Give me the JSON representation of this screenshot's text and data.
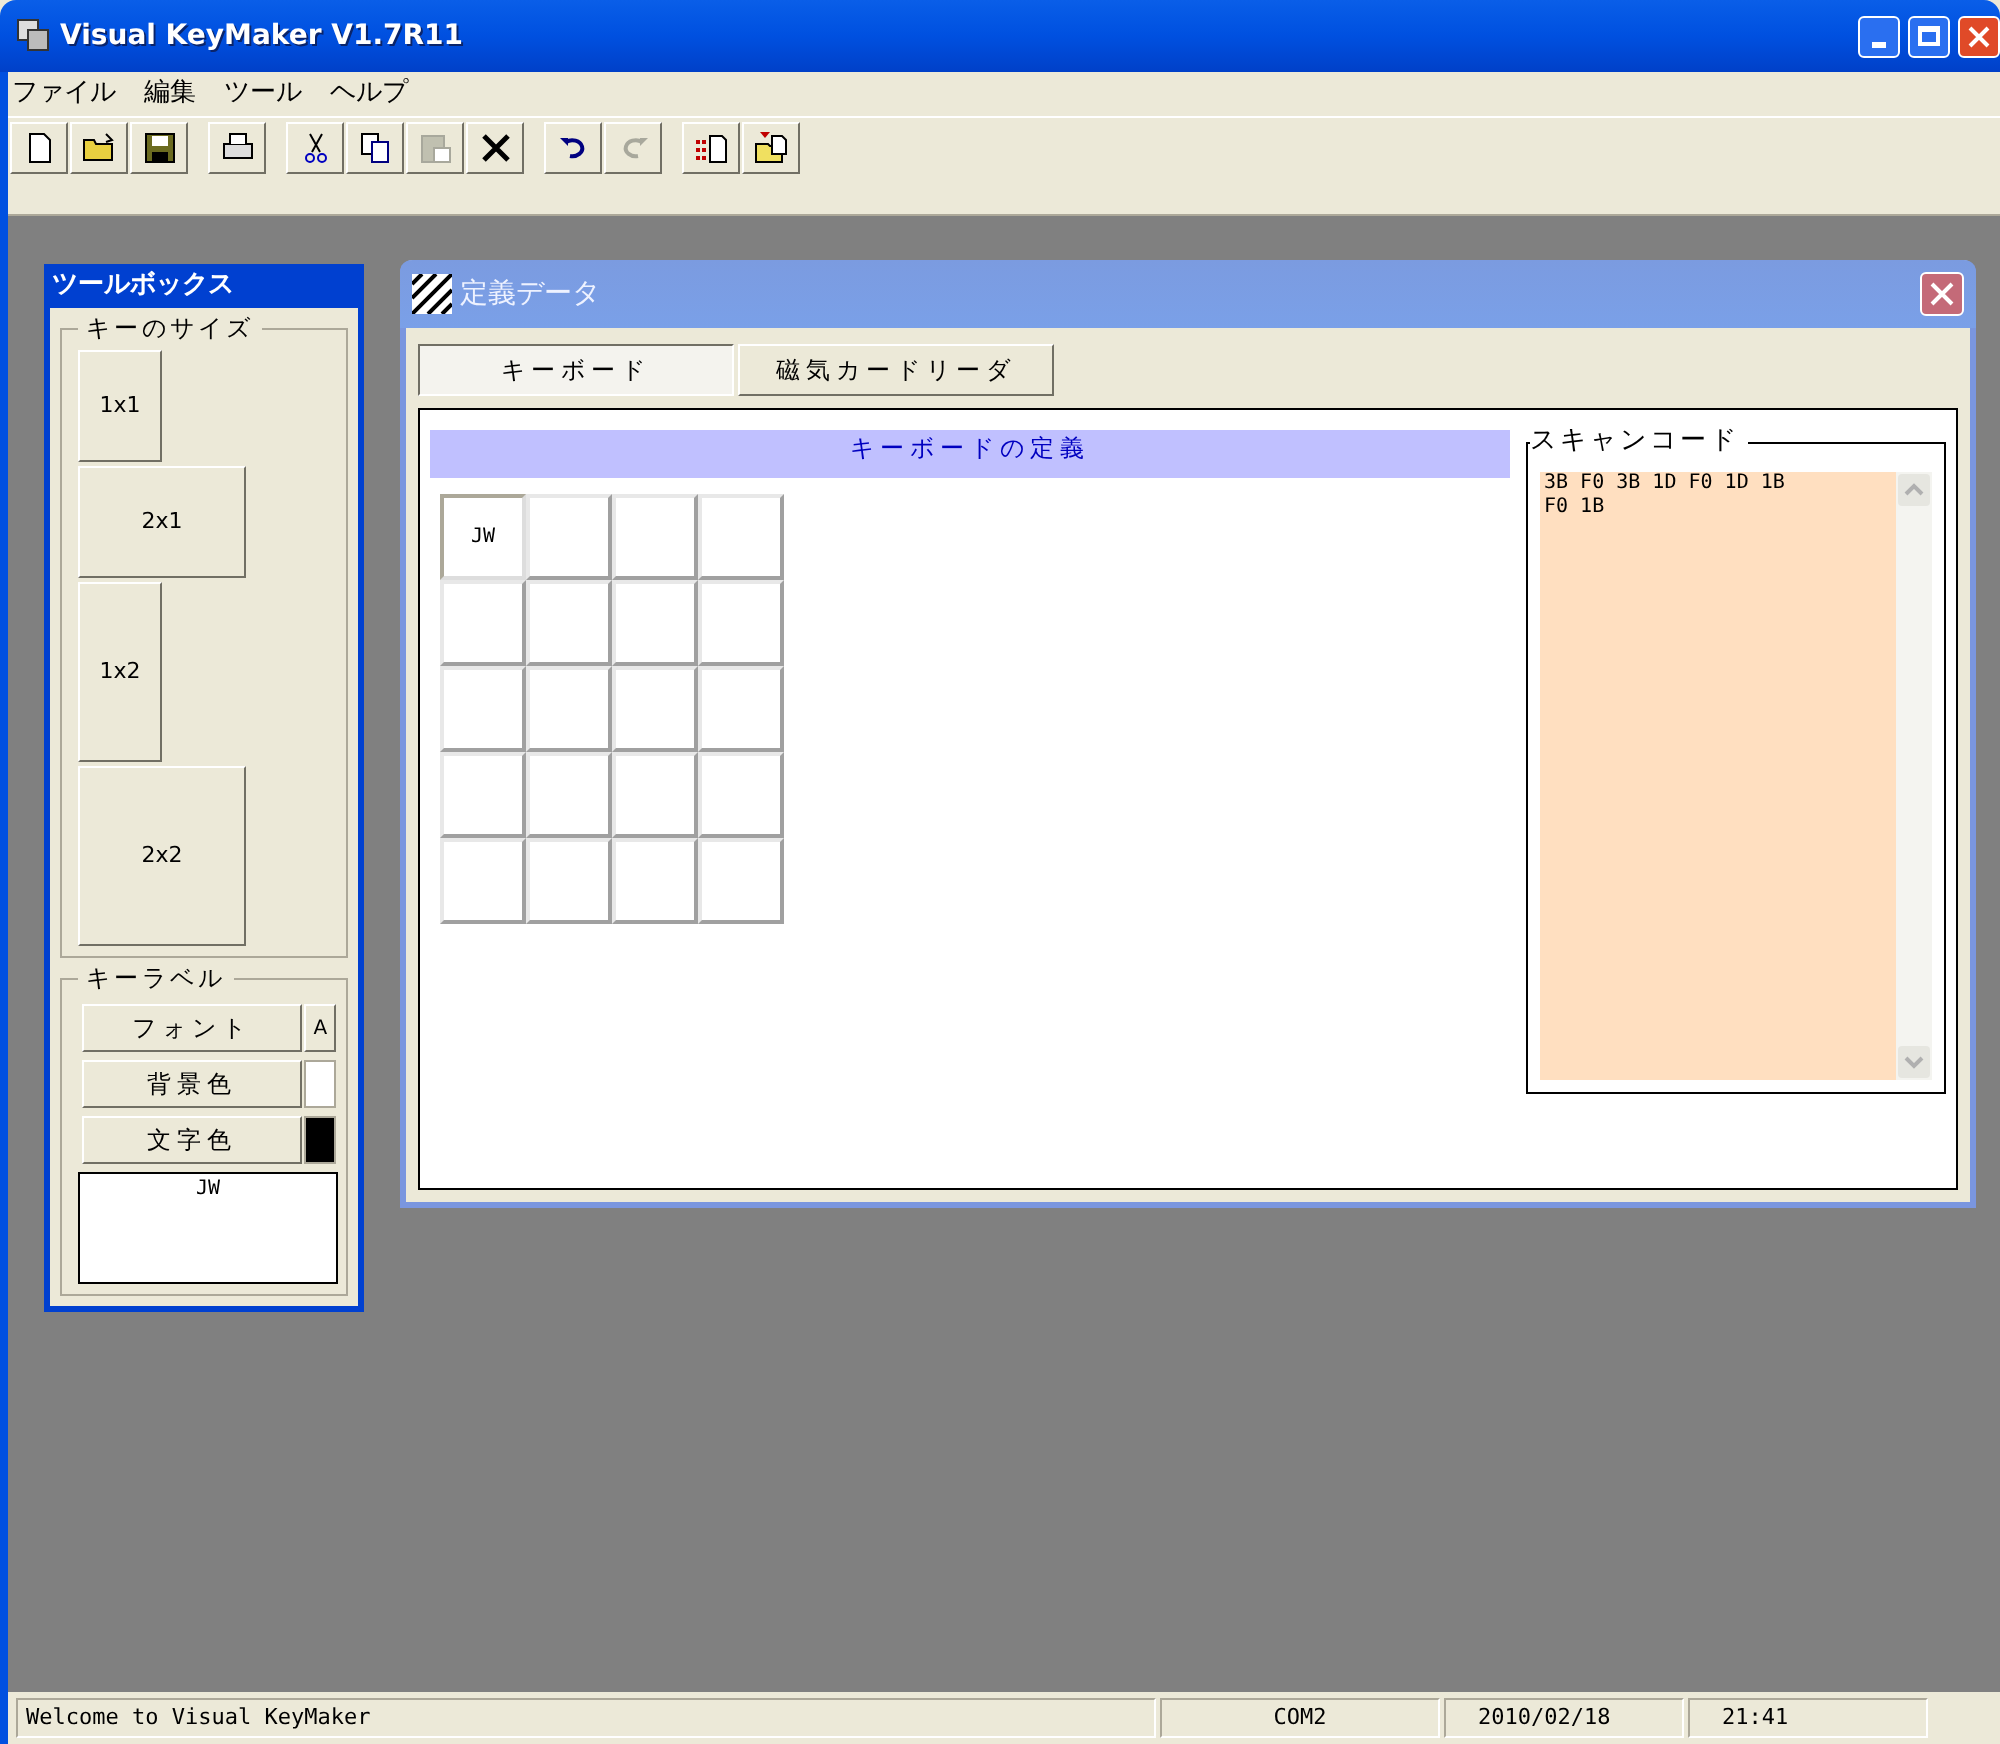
{
  "window": {
    "title": "Visual KeyMaker V1.7R11"
  },
  "menu": [
    "ファイル",
    "編集",
    "ツール",
    "ヘルプ"
  ],
  "toolbar": [
    [
      {
        "kind": "new",
        "disabled": false
      },
      {
        "kind": "open",
        "disabled": false
      },
      {
        "kind": "save",
        "disabled": false
      }
    ],
    [
      {
        "kind": "print",
        "disabled": false
      }
    ],
    [
      {
        "kind": "cut",
        "disabled": false
      },
      {
        "kind": "copy",
        "disabled": false
      },
      {
        "kind": "paste",
        "disabled": true
      },
      {
        "kind": "delete",
        "disabled": false
      }
    ],
    [
      {
        "kind": "undo",
        "disabled": false
      },
      {
        "kind": "redo",
        "disabled": true
      }
    ],
    [
      {
        "kind": "grid",
        "disabled": false
      },
      {
        "kind": "import",
        "disabled": false
      }
    ]
  ],
  "toolbox": {
    "title": "ツールボックス",
    "key_size": {
      "legend": "キーのサイズ",
      "buttons": [
        "1x1",
        "2x1",
        "1x2",
        "2x2"
      ]
    },
    "key_label": {
      "legend": "キーラベル",
      "buttons": [
        {
          "label": "フォント",
          "kind": "font",
          "swatch": "A"
        },
        {
          "label": "背景色",
          "kind": "color",
          "color": "#ffffff"
        },
        {
          "label": "文字色",
          "kind": "color",
          "color": "#000000"
        }
      ],
      "text": "JW"
    }
  },
  "child": {
    "title": "定義データ",
    "tabs": [
      {
        "label": "キーボード",
        "selected": true
      },
      {
        "label": "磁気カードリーダ",
        "selected": false
      }
    ],
    "keyboard_heading": "キーボードの定義",
    "keys": [
      [
        {
          "label": "JW",
          "selected": true
        },
        {
          "selected": false
        },
        {
          "selected": false
        },
        {
          "selected": false
        }
      ],
      [
        {
          "selected": false
        },
        {
          "selected": false
        },
        {
          "selected": false
        },
        {
          "selected": false
        }
      ],
      [
        {
          "selected": false
        },
        {
          "selected": false
        },
        {
          "selected": false
        },
        {
          "selected": false
        }
      ],
      [
        {
          "selected": false
        },
        {
          "selected": false
        },
        {
          "selected": false
        },
        {
          "selected": false
        }
      ],
      [
        {
          "selected": false
        },
        {
          "selected": false
        },
        {
          "selected": false
        },
        {
          "selected": false
        }
      ]
    ],
    "scan_code": {
      "legend": "スキャンコード",
      "lines": [
        "3B F0 3B 1D F0 1D 1B",
        "F0 1B"
      ]
    }
  },
  "status_bar": [
    "Welcome to Visual KeyMaker",
    "COM2",
    "2010/02/18",
    "21:41"
  ]
}
